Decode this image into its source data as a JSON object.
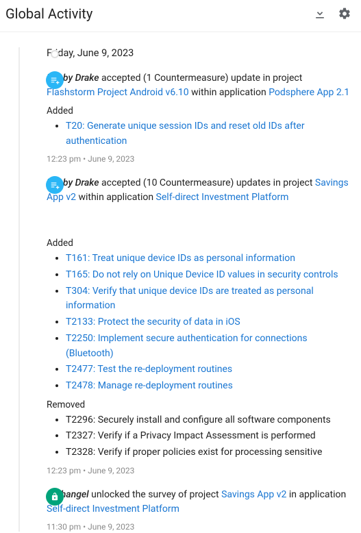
{
  "header": {
    "title": "Global Activity"
  },
  "dateHeader": "Friday, June 9, 2023",
  "events": [
    {
      "icon": "list-plus",
      "actor": "Bobby Drake",
      "verb": " accepted (1 Countermeasure) update in project ",
      "projectLink": "Flashstorm Project Android v6.10",
      "mid": " within application ",
      "appLink": "Podsphere App 2.1",
      "addedLabel": "Added",
      "added": [
        "T20: Generate unique session IDs and reset old IDs after authentication"
      ],
      "ts": "12:23 pm  •  June 9, 2023"
    },
    {
      "icon": "list-plus",
      "actor": "Bobby Drake",
      "verb": " accepted (10 Countermeasure) updates in project ",
      "projectLink": "Savings App v2",
      "mid": " within application ",
      "appLink": "Self-direct Investment Platform",
      "addedLabel": "Added",
      "added": [
        "T161: Treat unique device IDs as personal information",
        "T165: Do not rely on Unique Device ID values in security controls",
        "T304: Verify that unique device IDs are treated as personal information",
        "T2133: Protect the security of data in iOS",
        "T2250: Implement secure authentication for connections (Bluetooth)",
        "T2477: Test the re-deployment routines",
        "T2478: Manage re-deployment routines"
      ],
      "removedLabel": "Removed",
      "removed": [
        "T2296: Securely install and configure all software components",
        "T2327: Verify if a Privacy Impact Assessment is performed",
        "T2328: Verify if proper policies exist for processing sensitive"
      ],
      "ts": "12:23 pm  •  June 9, 2023"
    },
    {
      "icon": "unlock",
      "actor": "Archangel",
      "verb": " unlocked the survey of project ",
      "projectLink": "Savings App v2",
      "mid": " in application ",
      "appLink": "Self-direct Investment Platform",
      "ts": "11:30 pm  •  June 9, 2023"
    }
  ]
}
